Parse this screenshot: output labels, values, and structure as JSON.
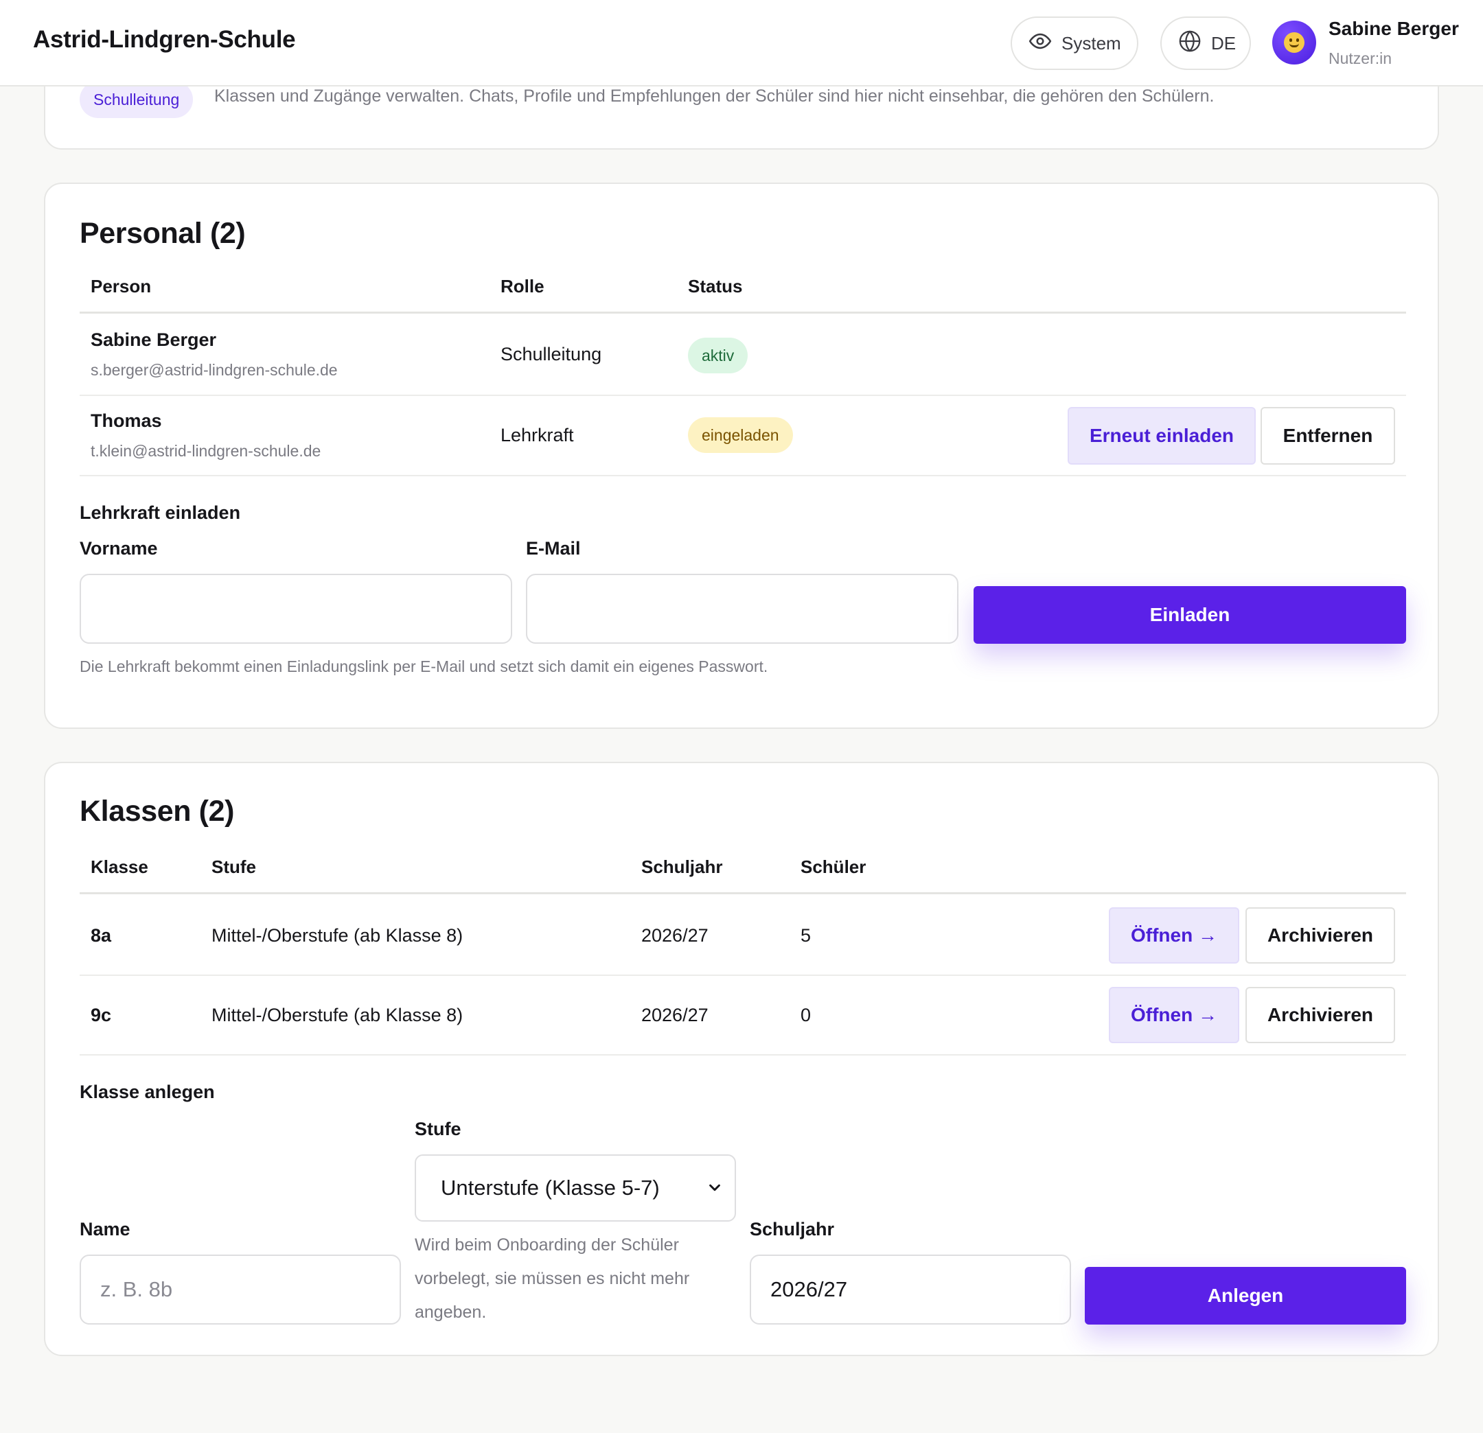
{
  "header": {
    "app_title": "Astrid-Lindgren-Schule",
    "theme_label": "System",
    "lang_label": "DE",
    "user_name": "Sabine Berger",
    "user_role": "Nutzer:in"
  },
  "intro": {
    "role_chip": "Schulleitung",
    "text": "Klassen und Zugänge verwalten. Chats, Profile und Empfehlungen der Schüler sind hier nicht einsehbar, die gehören den Schülern."
  },
  "personal": {
    "title": "Personal (2)",
    "columns": [
      "Person",
      "Rolle",
      "Status"
    ],
    "rows": [
      {
        "name": "Sabine Berger",
        "email": "s.berger@astrid-lindgren-schule.de",
        "role": "Schulleitung",
        "status": "aktiv"
      },
      {
        "name": "Thomas",
        "email": "t.klein@astrid-lindgren-schule.de",
        "role": "Lehrkraft",
        "status": "eingeladen",
        "reinvite_label": "Erneut einladen",
        "remove_label": "Entfernen"
      }
    ],
    "invite": {
      "heading": "Lehrkraft einladen",
      "firstname_label": "Vorname",
      "firstname_value": "",
      "email_label": "E-Mail",
      "email_value": "",
      "button_label": "Einladen",
      "help": "Die Lehrkraft bekommt einen Einladungslink per E-Mail und setzt sich damit ein eigenes Passwort."
    }
  },
  "klassen": {
    "title": "Klassen (2)",
    "columns": [
      "Klasse",
      "Stufe",
      "Schuljahr",
      "Schüler"
    ],
    "rows": [
      {
        "klasse": "8a",
        "stufe": "Mittel-/Oberstufe (ab Klasse 8)",
        "schuljahr": "2026/27",
        "schueler": "5",
        "open_label": "Öffnen →",
        "archive_label": "Archivieren"
      },
      {
        "klasse": "9c",
        "stufe": "Mittel-/Oberstufe (ab Klasse 8)",
        "schuljahr": "2026/27",
        "schueler": "0",
        "open_label": "Öffnen →",
        "archive_label": "Archivieren"
      }
    ],
    "create": {
      "heading": "Klasse anlegen",
      "name_label": "Name",
      "name_placeholder": "z. B. 8b",
      "stufe_label": "Stufe",
      "stufe_selected": "Unterstufe (Klasse 5-7)",
      "stufe_help": "Wird beim Onboarding der Schüler vorbelegt, sie müssen es nicht mehr angeben.",
      "schuljahr_label": "Schuljahr",
      "schuljahr_value": "2026/27",
      "button_label": "Anlegen"
    }
  },
  "colors": {
    "accent": "#5b21e8",
    "accent_soft": "#ece8fc",
    "status_active_bg": "#dcf6e4",
    "status_invited_bg": "#fdf2c2"
  },
  "icons": {
    "theme": "eye-icon",
    "language": "globe-icon",
    "avatar": "smiley-avatar",
    "select": "chevron-down-icon"
  }
}
